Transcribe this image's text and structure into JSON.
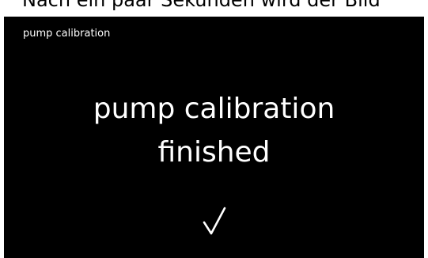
{
  "caption": {
    "text": "Nach ein paar Sekunden wird der Bild"
  },
  "screen": {
    "header_title": "pump calibration",
    "message_line_1": "pump calibration",
    "message_line_2": "finished",
    "status_icon": "checkmark-icon",
    "background_color": "#000000",
    "text_color": "#ffffff"
  }
}
